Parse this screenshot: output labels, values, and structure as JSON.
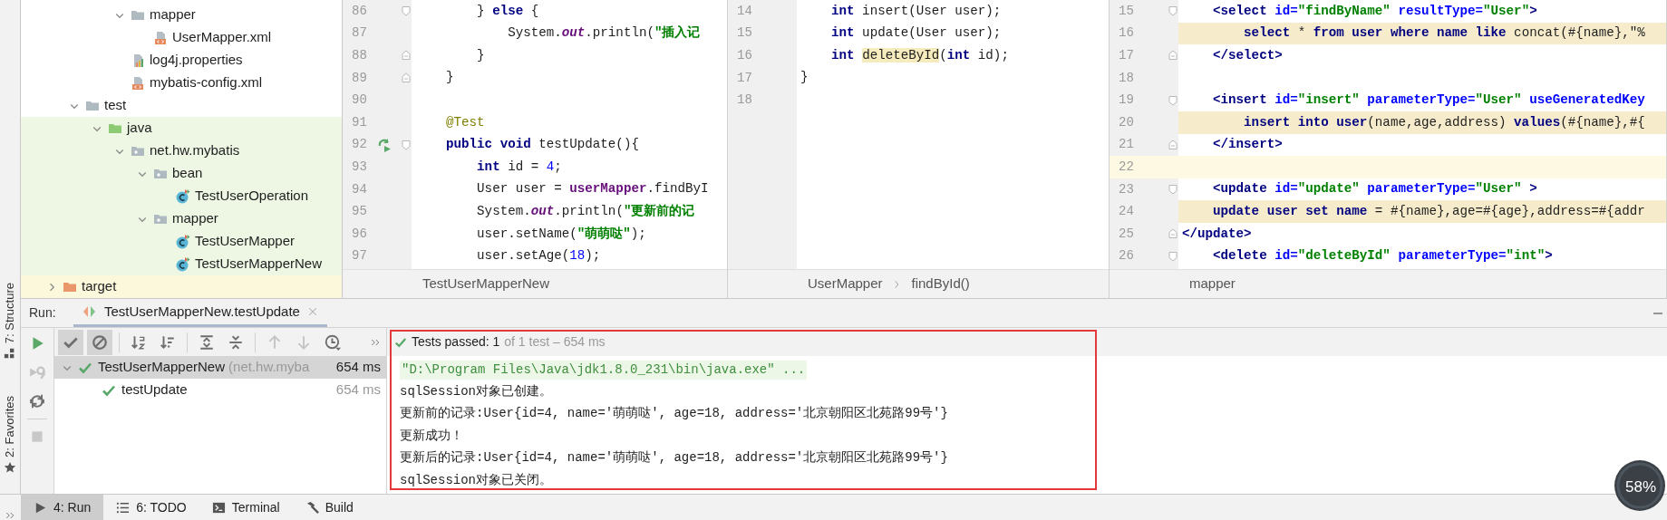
{
  "tool_stripe": [
    {
      "label": "7: Structure",
      "kind": "structure"
    },
    {
      "label": "2: Favorites",
      "kind": "favorites"
    }
  ],
  "project_tree": [
    {
      "children": [
        {
          "children": [
            {
              "children": [
                {
                  "label": "mapper",
                  "kind": "folder",
                  "expanded": true,
                  "children": [
                    {
                      "label": "UserMapper.xml",
                      "kind": "xml-file"
                    }
                  ]
                },
                {
                  "label": "log4j.properties",
                  "kind": "properties-file"
                },
                {
                  "label": "mybatis-config.xml",
                  "kind": "xml-file"
                }
              ]
            }
          ]
        },
        {
          "label": "test",
          "kind": "folder",
          "expanded": true,
          "children": [
            {
              "label": "java",
              "kind": "source-folder",
              "expanded": true,
              "children": [
                {
                  "label": "net.hw.mybatis",
                  "kind": "package",
                  "expanded": true,
                  "children": [
                    {
                      "label": "bean",
                      "kind": "package",
                      "expanded": true,
                      "children": [
                        {
                          "label": "TestUserOperation",
                          "kind": "test-class"
                        }
                      ]
                    },
                    {
                      "label": "mapper",
                      "kind": "package",
                      "expanded": true,
                      "children": [
                        {
                          "label": "TestUserMapper",
                          "kind": "test-class"
                        },
                        {
                          "label": "TestUserMapperNew",
                          "kind": "test-class"
                        }
                      ]
                    }
                  ]
                }
              ]
            }
          ]
        }
      ]
    },
    {
      "label": "target",
      "kind": "excluded-folder",
      "expanded": false
    }
  ],
  "editors": [
    {
      "breadcrumbs": [
        "TestUserMapperNew"
      ],
      "lines": [
        {
          "number": "86",
          "fold_start": true,
          "tokens": [
            {
              "text": "        } ",
              "kind": "plain"
            },
            {
              "text": "else",
              "kind": "kw"
            },
            {
              "text": " {",
              "kind": "plain"
            }
          ]
        },
        {
          "number": "87",
          "tokens": [
            {
              "text": "            System.",
              "kind": "plain"
            },
            {
              "text": "out",
              "kind": "static-field"
            },
            {
              "text": ".println(",
              "kind": "plain"
            },
            {
              "text": "\"插入记",
              "kind": "str"
            }
          ]
        },
        {
          "number": "88",
          "fold_end": true,
          "tokens": [
            {
              "text": "        }",
              "kind": "plain"
            }
          ]
        },
        {
          "number": "89",
          "fold_end": true,
          "tokens": [
            {
              "text": "    }",
              "kind": "plain"
            }
          ]
        },
        {
          "number": "90"
        },
        {
          "number": "91",
          "tokens": [
            {
              "text": "    @Test",
              "kind": "ann"
            }
          ]
        },
        {
          "number": "92",
          "fold_start": true,
          "runnable": true,
          "tokens": [
            {
              "text": "    public void",
              "kind": "kw"
            },
            {
              "text": " testUpdate(){",
              "kind": "plain"
            }
          ]
        },
        {
          "number": "93",
          "tokens": [
            {
              "text": "        int",
              "kind": "kw"
            },
            {
              "text": " id = ",
              "kind": "plain"
            },
            {
              "text": "4",
              "kind": "num"
            },
            {
              "text": ";",
              "kind": "plain"
            }
          ]
        },
        {
          "number": "94",
          "tokens": [
            {
              "text": "        User user = ",
              "kind": "plain"
            },
            {
              "text": "userMapper",
              "kind": "field"
            },
            {
              "text": ".findByI",
              "kind": "plain"
            }
          ]
        },
        {
          "number": "95",
          "tokens": [
            {
              "text": "        System.",
              "kind": "plain"
            },
            {
              "text": "out",
              "kind": "static-field"
            },
            {
              "text": ".println(",
              "kind": "plain"
            },
            {
              "text": "\"更新前的记",
              "kind": "str"
            }
          ]
        },
        {
          "number": "96",
          "tokens": [
            {
              "text": "        user.setName(",
              "kind": "plain"
            },
            {
              "text": "\"萌萌哒\"",
              "kind": "str"
            },
            {
              "text": ");",
              "kind": "plain"
            }
          ]
        },
        {
          "number": "97",
          "tokens": [
            {
              "text": "        user.setAge(",
              "kind": "plain"
            },
            {
              "text": "18",
              "kind": "num"
            },
            {
              "text": ");",
              "kind": "plain"
            }
          ]
        }
      ]
    },
    {
      "breadcrumbs": [
        "UserMapper",
        "findById()"
      ],
      "lines": [
        {
          "number": "14",
          "tokens": [
            {
              "text": "    int",
              "kind": "kw"
            },
            {
              "text": " insert(User user);",
              "kind": "plain"
            }
          ]
        },
        {
          "number": "15",
          "tokens": [
            {
              "text": "    int",
              "kind": "kw"
            },
            {
              "text": " update(User user);",
              "kind": "plain"
            }
          ]
        },
        {
          "number": "16",
          "tokens": [
            {
              "text": "    int ",
              "kind": "kw"
            },
            {
              "text": "deleteById",
              "kind": "match"
            },
            {
              "text": "(",
              "kind": "plain"
            },
            {
              "text": "int",
              "kind": "kw"
            },
            {
              "text": " id);",
              "kind": "plain"
            }
          ]
        },
        {
          "number": "17",
          "tokens": [
            {
              "text": "}",
              "kind": "plain"
            }
          ]
        },
        {
          "number": "18"
        }
      ]
    },
    {
      "breadcrumbs": [
        "mapper"
      ],
      "lines": [
        {
          "number": "15",
          "fold_start": true,
          "tokens": [
            {
              "text": "    <select ",
              "kind": "tag"
            },
            {
              "text": "id=",
              "kind": "attr"
            },
            {
              "text": "\"findByName\" ",
              "kind": "val"
            },
            {
              "text": "resultType=",
              "kind": "attr"
            },
            {
              "text": "\"User\"",
              "kind": "val"
            },
            {
              "text": ">",
              "kind": "tag"
            }
          ]
        },
        {
          "number": "16",
          "kind": "injected",
          "tokens": [
            {
              "text": "        select",
              "kind": "kw"
            },
            {
              "text": " * ",
              "kind": "plain"
            },
            {
              "text": "from user where name like",
              "kind": "kw"
            },
            {
              "text": " concat(#{name},\"%",
              "kind": "plain"
            }
          ]
        },
        {
          "number": "17",
          "fold_end": true,
          "tokens": [
            {
              "text": "    </select>",
              "kind": "tag"
            }
          ]
        },
        {
          "number": "18"
        },
        {
          "number": "19",
          "fold_start": true,
          "tokens": [
            {
              "text": "    <insert ",
              "kind": "tag"
            },
            {
              "text": "id=",
              "kind": "attr"
            },
            {
              "text": "\"insert\" ",
              "kind": "val"
            },
            {
              "text": "parameterType=",
              "kind": "attr"
            },
            {
              "text": "\"User\" ",
              "kind": "val"
            },
            {
              "text": "useGeneratedKey",
              "kind": "attr"
            }
          ]
        },
        {
          "number": "20",
          "kind": "injected",
          "tokens": [
            {
              "text": "        insert into user",
              "kind": "kw"
            },
            {
              "text": "(name,age,address) ",
              "kind": "plain"
            },
            {
              "text": "values",
              "kind": "kw"
            },
            {
              "text": "(#{name},#{",
              "kind": "plain"
            }
          ]
        },
        {
          "number": "21",
          "fold_end": true,
          "tokens": [
            {
              "text": "    </insert>",
              "kind": "tag"
            }
          ]
        },
        {
          "number": "22",
          "kind": "caret"
        },
        {
          "number": "23",
          "fold_start": true,
          "tokens": [
            {
              "text": "    <update ",
              "kind": "tag"
            },
            {
              "text": "id=",
              "kind": "attr"
            },
            {
              "text": "\"update\" ",
              "kind": "val"
            },
            {
              "text": "parameterType=",
              "kind": "attr"
            },
            {
              "text": "\"User\" ",
              "kind": "val"
            },
            {
              "text": ">",
              "kind": "tag"
            }
          ]
        },
        {
          "number": "24",
          "kind": "injected",
          "tokens": [
            {
              "text": "    update user set name",
              "kind": "kw"
            },
            {
              "text": " = #{name},age=#{age},address=#{addr",
              "kind": "plain"
            }
          ]
        },
        {
          "number": "25",
          "fold_end": true,
          "tokens": [
            {
              "text": "</update>",
              "kind": "tag"
            }
          ]
        },
        {
          "number": "26",
          "fold_start": true,
          "tokens": [
            {
              "text": "    <delete ",
              "kind": "tag"
            },
            {
              "text": "id=",
              "kind": "attr"
            },
            {
              "text": "\"deleteById\" ",
              "kind": "val"
            },
            {
              "text": "parameterType=",
              "kind": "attr"
            },
            {
              "text": "\"int\"",
              "kind": "val"
            },
            {
              "text": ">",
              "kind": "tag"
            }
          ]
        }
      ]
    }
  ],
  "run_panel": {
    "title": "Run:",
    "tabs": [
      {
        "label": "TestUserMapperNew.testUpdate",
        "selected": true
      }
    ],
    "side_buttons": [
      {
        "kind": "run",
        "disabled": false
      },
      {
        "kind": "rerun-failed",
        "disabled": true
      },
      {
        "kind": "toggle-auto-test",
        "disabled": false
      },
      {
        "kind": "stop",
        "disabled": true
      }
    ],
    "toolbar": [
      {
        "kind": "show-passed",
        "selected": true,
        "disabled": false
      },
      {
        "kind": "show-ignored",
        "selected": true,
        "disabled": false
      },
      {
        "kind": "sort-alpha",
        "selected": false,
        "disabled": false
      },
      {
        "kind": "sort-duration",
        "selected": false,
        "disabled": false
      },
      {
        "kind": "expand-all",
        "selected": false,
        "disabled": false
      },
      {
        "kind": "collapse-all",
        "selected": false,
        "disabled": false
      },
      {
        "kind": "previous",
        "selected": false,
        "disabled": true
      },
      {
        "kind": "next",
        "selected": false,
        "disabled": true
      },
      {
        "kind": "history",
        "selected": false,
        "disabled": false
      }
    ],
    "test_tree": [
      {
        "label": "TestUserMapperNew",
        "detail": "(net.hw.myba",
        "duration": "654 ms",
        "passed": true,
        "selected": true,
        "expanded": true,
        "children": [
          {
            "label": "testUpdate",
            "duration": "654 ms",
            "passed": true,
            "selected": false
          }
        ]
      }
    ],
    "status": {
      "summary": "Tests passed: 1",
      "detail": "of 1 test – 654 ms",
      "passed": true
    },
    "console": [
      {
        "kind": "command",
        "text": "\"D:\\Program Files\\Java\\jdk1.8.0_231\\bin\\java.exe\" ..."
      },
      {
        "kind": "output",
        "text": "sqlSession对象已创建。"
      },
      {
        "kind": "output",
        "text": "更新前的记录:User{id=4, name='萌萌哒', age=18, address='北京朝阳区北苑路99号'}"
      },
      {
        "kind": "output",
        "text": "更新成功！"
      },
      {
        "kind": "output",
        "text": "更新后的记录:User{id=4, name='萌萌哒', age=18, address='北京朝阳区北苑路99号'}"
      },
      {
        "kind": "output",
        "text": "sqlSession对象已关闭。"
      }
    ]
  },
  "bottom_bar": [
    {
      "label": "4: Run",
      "kind": "run",
      "selected": true
    },
    {
      "label": "6: TODO",
      "kind": "todo",
      "selected": false
    },
    {
      "label": "Terminal",
      "kind": "terminal",
      "selected": false
    },
    {
      "label": "Build",
      "kind": "build",
      "selected": false
    }
  ],
  "annotations": [
    {
      "kind": "frame"
    }
  ],
  "floating_meter": {
    "reading": "58%"
  }
}
